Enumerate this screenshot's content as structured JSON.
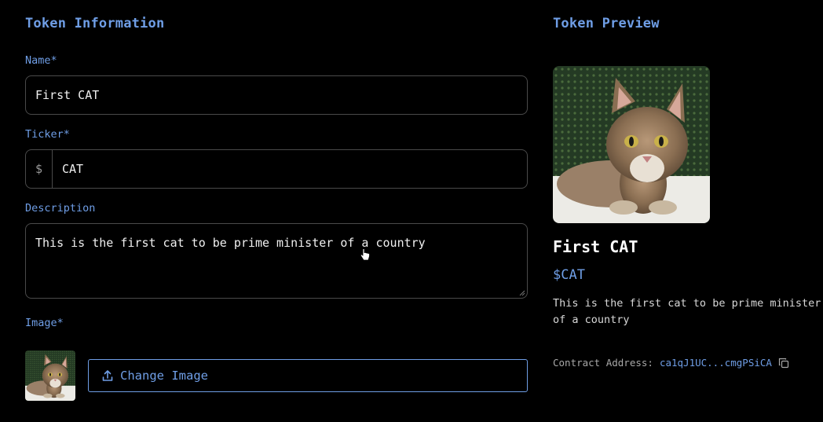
{
  "form": {
    "heading": "Token Information",
    "name_label": "Name*",
    "name_value": "First CAT",
    "ticker_label": "Ticker*",
    "ticker_prefix": "$",
    "ticker_value": "CAT",
    "description_label": "Description",
    "description_value": "This is the first cat to be prime minister of a country",
    "image_label": "Image*",
    "change_image_label": "Change Image"
  },
  "preview": {
    "heading": "Token Preview",
    "name": "First CAT",
    "ticker": "$CAT",
    "description": "This is the first cat to be prime minister of a country",
    "contract_label": "Contract Address:",
    "contract_address": "ca1qJ1UC...cmgPSiCA"
  },
  "colors": {
    "accent": "#6f9ee6",
    "background": "#000000",
    "border": "#4a4a4a"
  },
  "icons": [
    "upload-icon",
    "copy-icon",
    "hand-pointer-cursor"
  ]
}
